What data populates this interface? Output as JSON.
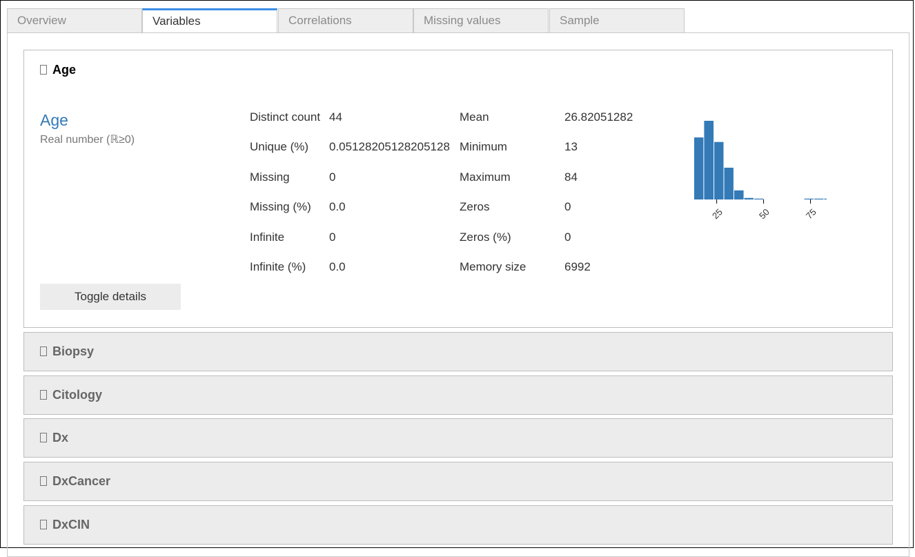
{
  "tabs": [
    {
      "label": "Overview",
      "active": false
    },
    {
      "label": "Variables",
      "active": true
    },
    {
      "label": "Correlations",
      "active": false
    },
    {
      "label": "Missing values",
      "active": false
    },
    {
      "label": "Sample",
      "active": false
    }
  ],
  "variable": {
    "header": "Age",
    "name": "Age",
    "type_label": "Real number (ℝ≥0)",
    "stats_left": [
      {
        "label": "Distinct count",
        "value": "44"
      },
      {
        "label": "Unique (%)",
        "value": "0.05128205128205128"
      },
      {
        "label": "Missing",
        "value": "0"
      },
      {
        "label": "Missing (%)",
        "value": "0.0"
      },
      {
        "label": "Infinite",
        "value": "0"
      },
      {
        "label": "Infinite (%)",
        "value": "0.0"
      }
    ],
    "stats_right": [
      {
        "label": "Mean",
        "value": "26.82051282"
      },
      {
        "label": "Minimum",
        "value": "13"
      },
      {
        "label": "Maximum",
        "value": "84"
      },
      {
        "label": "Zeros",
        "value": "0"
      },
      {
        "label": "Zeros (%)",
        "value": "0"
      },
      {
        "label": "Memory size",
        "value": "6992"
      }
    ],
    "toggle_label": "Toggle details"
  },
  "collapsed_variables": [
    "Biopsy",
    "Citology",
    "Dx",
    "DxCancer",
    "DxCIN"
  ],
  "chart_data": {
    "type": "bar",
    "title": "",
    "bin_edges": [
      13,
      18.3,
      23.7,
      29,
      34.3,
      39.7,
      45,
      50.3,
      55.7,
      61,
      66.3,
      71.7,
      77,
      82.3,
      84
    ],
    "values": [
      0.041,
      0.052,
      0.038,
      0.021,
      0.006,
      0.001,
      0.0003,
      0,
      0,
      0,
      0,
      0.0004,
      0.0004,
      0.0004
    ],
    "xticks": [
      25,
      50,
      75
    ],
    "xlim": [
      13,
      84
    ],
    "ylim": [
      0,
      0.052
    ],
    "color": "#337ab7"
  }
}
